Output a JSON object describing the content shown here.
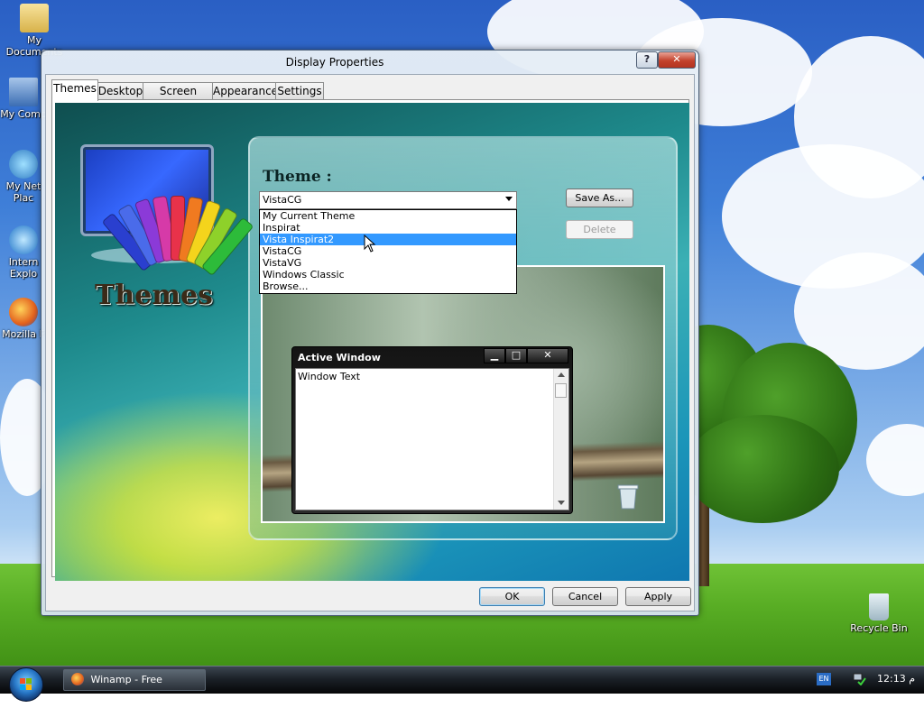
{
  "desktop": {
    "icons": [
      {
        "label": "My Documents"
      },
      {
        "label": "My Comp"
      },
      {
        "label": "My Net Plac"
      },
      {
        "label": "Intern Explo"
      },
      {
        "label": "Mozilla F"
      },
      {
        "label": "Recycle Bin"
      }
    ]
  },
  "dialog": {
    "title": "Display Properties",
    "help_label": "?",
    "close_label": "✕",
    "tabs": [
      {
        "label": "Themes"
      },
      {
        "label": "Desktop"
      },
      {
        "label": "Screen Saver"
      },
      {
        "label": "Appearance"
      },
      {
        "label": "Settings"
      }
    ],
    "themes_tab": {
      "heading": "Theme :",
      "logo_text": "Themes",
      "selected_value": "VistaCG",
      "options": [
        "My Current Theme",
        "Inspirat",
        "Vista Inspirat2",
        "VistaCG",
        "VistaVG",
        "Windows Classic",
        "Browse..."
      ],
      "highlighted_option": "Vista Inspirat2",
      "save_as_label": "Save As...",
      "delete_label": "Delete",
      "preview": {
        "active_window_title": "Active Window",
        "window_text": "Window Text",
        "min_label": "▁",
        "max_label": "□",
        "close_label": "✕"
      }
    },
    "buttons": {
      "ok": "OK",
      "cancel": "Cancel",
      "apply": "Apply"
    }
  },
  "taskbar": {
    "task_label": "Winamp - Free downlo...",
    "lang": "EN",
    "clock": "12:13 م"
  },
  "colors": {
    "selection": "#3399ff",
    "close_button": "#c3412b"
  }
}
